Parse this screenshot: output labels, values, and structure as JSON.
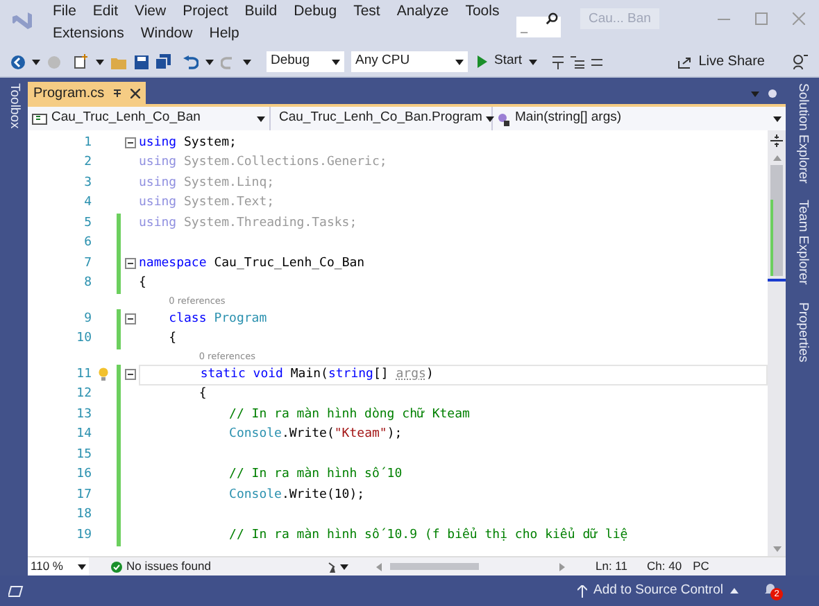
{
  "menu": {
    "top_row": [
      "File",
      "Edit",
      "View",
      "Project",
      "Build",
      "Debug",
      "Test",
      "Analyze",
      "Tools"
    ],
    "bottom_row": [
      "Extensions",
      "Window",
      "Help"
    ]
  },
  "search": {
    "placeholder": "_"
  },
  "window": {
    "title": "Cau... Ban"
  },
  "toolbar": {
    "configuration": "Debug",
    "platform": "Any CPU",
    "start": "Start",
    "live_share": "Live Share"
  },
  "toolbox": {
    "label": "Toolbox"
  },
  "tabs": [
    {
      "label": "Program.cs",
      "selected": true
    }
  ],
  "navbar": {
    "project": "Cau_Truc_Lenh_Co_Ban",
    "type": "Cau_Truc_Lenh_Co_Ban.Program",
    "member": "Main(string[] args)"
  },
  "lines": [
    {
      "kind": "code",
      "number": "1",
      "changed": false,
      "fold": true,
      "current": false,
      "bulb": false,
      "tokens": [
        {
          "text": "using",
          "kind": "keyword"
        },
        {
          "text": " System;",
          "kind": "plain"
        }
      ]
    },
    {
      "kind": "code",
      "number": "2",
      "changed": false,
      "fold": false,
      "current": false,
      "bulb": false,
      "tokens": [
        {
          "text": "using",
          "kind": "faded-keyword"
        },
        {
          "text": " System.Collections.Generic;",
          "kind": "faded"
        }
      ]
    },
    {
      "kind": "code",
      "number": "3",
      "changed": false,
      "fold": false,
      "current": false,
      "bulb": false,
      "tokens": [
        {
          "text": "using",
          "kind": "faded-keyword"
        },
        {
          "text": " System.Linq;",
          "kind": "faded"
        }
      ]
    },
    {
      "kind": "code",
      "number": "4",
      "changed": false,
      "fold": false,
      "current": false,
      "bulb": false,
      "tokens": [
        {
          "text": "using",
          "kind": "faded-keyword"
        },
        {
          "text": " System.Text;",
          "kind": "faded"
        }
      ]
    },
    {
      "kind": "code",
      "number": "5",
      "changed": true,
      "fold": false,
      "current": false,
      "bulb": false,
      "tokens": [
        {
          "text": "using",
          "kind": "faded-keyword"
        },
        {
          "text": " System.Threading.Tasks;",
          "kind": "faded"
        }
      ]
    },
    {
      "kind": "code",
      "number": "6",
      "changed": true,
      "fold": false,
      "current": false,
      "bulb": false
    },
    {
      "kind": "code",
      "number": "7",
      "changed": true,
      "fold": true,
      "current": false,
      "bulb": false,
      "tokens": [
        {
          "text": "namespace",
          "kind": "keyword"
        },
        {
          "text": " Cau_Truc_Lenh_Co_Ban",
          "kind": "plain"
        }
      ]
    },
    {
      "kind": "code",
      "number": "8",
      "changed": true,
      "fold": false,
      "current": false,
      "bulb": false,
      "tokens": [
        {
          "text": "{",
          "kind": "plain"
        }
      ]
    },
    {
      "kind": "codelens",
      "text": "0 references"
    },
    {
      "kind": "code",
      "number": "9",
      "changed": true,
      "fold": true,
      "current": false,
      "bulb": false,
      "tokens": [
        {
          "text": "    class",
          "kind": "keyword"
        },
        {
          "text": " Program",
          "kind": "type"
        }
      ]
    },
    {
      "kind": "code",
      "number": "10",
      "changed": true,
      "fold": false,
      "current": false,
      "bulb": false,
      "tokens": [
        {
          "text": "    {",
          "kind": "plain"
        }
      ]
    },
    {
      "kind": "codelens",
      "text": "0 references"
    },
    {
      "kind": "code",
      "number": "11",
      "changed": true,
      "fold": true,
      "current": true,
      "bulb": true,
      "tokens": [
        {
          "text": "        static void",
          "kind": "keyword"
        },
        {
          "text": " Main(",
          "kind": "plain"
        },
        {
          "text": "string",
          "kind": "keyword"
        },
        {
          "text": "[] ",
          "kind": "plain"
        },
        {
          "text": "args",
          "kind": "param"
        },
        {
          "text": ")",
          "kind": "plain"
        }
      ]
    },
    {
      "kind": "code",
      "number": "12",
      "changed": true,
      "fold": false,
      "current": false,
      "bulb": false,
      "tokens": [
        {
          "text": "        {",
          "kind": "plain"
        }
      ]
    },
    {
      "kind": "code",
      "number": "13",
      "changed": true,
      "fold": false,
      "current": false,
      "bulb": false,
      "tokens": [
        {
          "text": "            // In ra màn hình dòng chữ Kteam",
          "kind": "comment"
        }
      ]
    },
    {
      "kind": "code",
      "number": "14",
      "changed": true,
      "fold": false,
      "current": false,
      "bulb": false,
      "tokens": [
        {
          "text": "            Console",
          "kind": "type"
        },
        {
          "text": ".Write(",
          "kind": "plain"
        },
        {
          "text": "\"Kteam\"",
          "kind": "string"
        },
        {
          "text": ");",
          "kind": "plain"
        }
      ]
    },
    {
      "kind": "code",
      "number": "15",
      "changed": true,
      "fold": false,
      "current": false,
      "bulb": false
    },
    {
      "kind": "code",
      "number": "16",
      "changed": true,
      "fold": false,
      "current": false,
      "bulb": false,
      "tokens": [
        {
          "text": "            // In ra màn hình số 10",
          "kind": "comment"
        }
      ]
    },
    {
      "kind": "code",
      "number": "17",
      "changed": true,
      "fold": false,
      "current": false,
      "bulb": false,
      "tokens": [
        {
          "text": "            Console",
          "kind": "type"
        },
        {
          "text": ".Write(10);",
          "kind": "plain"
        }
      ]
    },
    {
      "kind": "code",
      "number": "18",
      "changed": true,
      "fold": false,
      "current": false,
      "bulb": false
    },
    {
      "kind": "code",
      "number": "19",
      "changed": true,
      "fold": false,
      "current": false,
      "bulb": false,
      "tokens": [
        {
          "text": "            // In ra màn hình số 10.9 (f biểu thị cho kiểu dữ liệ",
          "kind": "comment"
        }
      ]
    }
  ],
  "editor_status": {
    "zoom": "110 %",
    "issues": "No issues found",
    "line": "Ln: 11",
    "column": "Ch: 40",
    "mode": "PC"
  },
  "right_panels": [
    "Solution Explorer",
    "Team Explorer",
    "Properties"
  ],
  "status_bar": {
    "source_control": "Add to Source Control",
    "notifications": "2"
  }
}
